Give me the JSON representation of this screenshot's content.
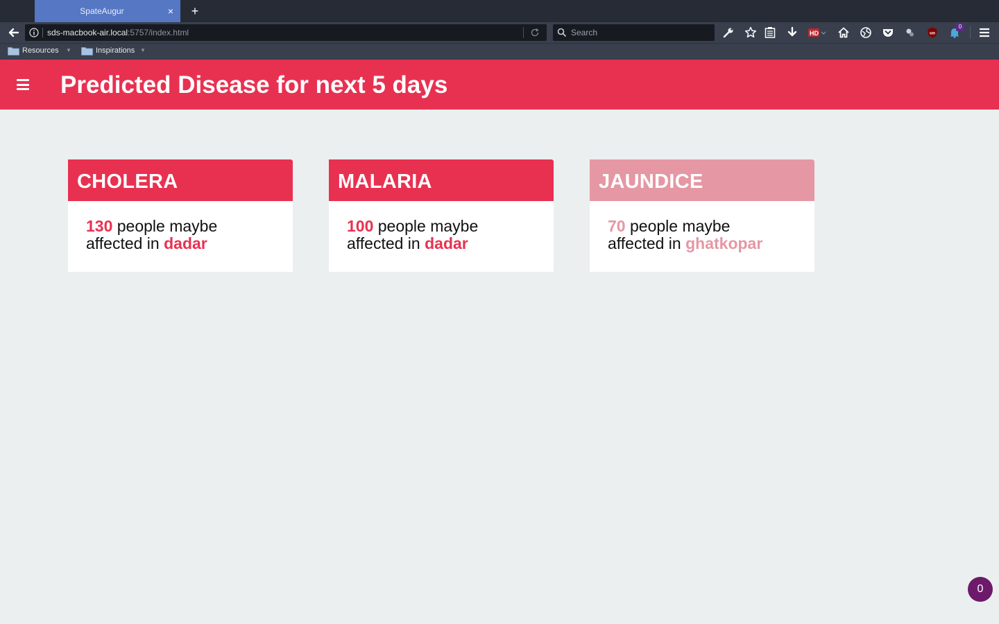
{
  "browser": {
    "tab_title": "SpateAugur",
    "tab_close": "×",
    "new_tab": "+",
    "url_host": "sds-macbook-air.local",
    "url_path": ":5757/index.html",
    "search_placeholder": "Search",
    "notification_count": "0",
    "bookmarks": [
      {
        "label": "Resources"
      },
      {
        "label": "Inspirations"
      }
    ]
  },
  "header": {
    "title": "Predicted Disease for next 5 days"
  },
  "cards": [
    {
      "name": "CHOLERA",
      "count": "130",
      "text_a": " people maybe",
      "text_b": "affected in ",
      "location": "dadar",
      "color": "#e83151"
    },
    {
      "name": "MALARIA",
      "count": "100",
      "text_a": " people maybe",
      "text_b": "affected in ",
      "location": "dadar",
      "color": "#e83151"
    },
    {
      "name": "JAUNDICE",
      "count": "70",
      "text_a": " people maybe",
      "text_b": "affected in ",
      "location": "ghatkopar",
      "color": "#e597a4"
    }
  ],
  "fab": {
    "label": "0",
    "color": "#6d1a6b"
  }
}
